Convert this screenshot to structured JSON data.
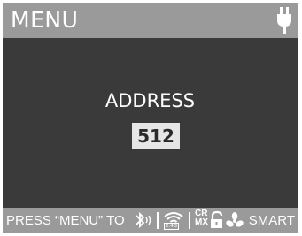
{
  "header": {
    "title": "MENU",
    "icon": "power-plug-icon"
  },
  "main": {
    "label": "ADDRESS",
    "value": "512"
  },
  "footer": {
    "hint": "PRESS “MENU” TO",
    "bluetooth_icon": "bluetooth-icon",
    "wifi_icon": "wifi-icon",
    "wifi_band": "2.4G",
    "crmx_line1": "CR",
    "crmx_line2": "MX",
    "lock_icon": "lock-icon",
    "fan_icon": "fan-icon",
    "mode": "SMART"
  },
  "colors": {
    "screen_bg": "#3a3a3a",
    "bar_bg": "#9a9a9a",
    "text": "#ffffff",
    "value_bg": "#e6e6e6"
  }
}
